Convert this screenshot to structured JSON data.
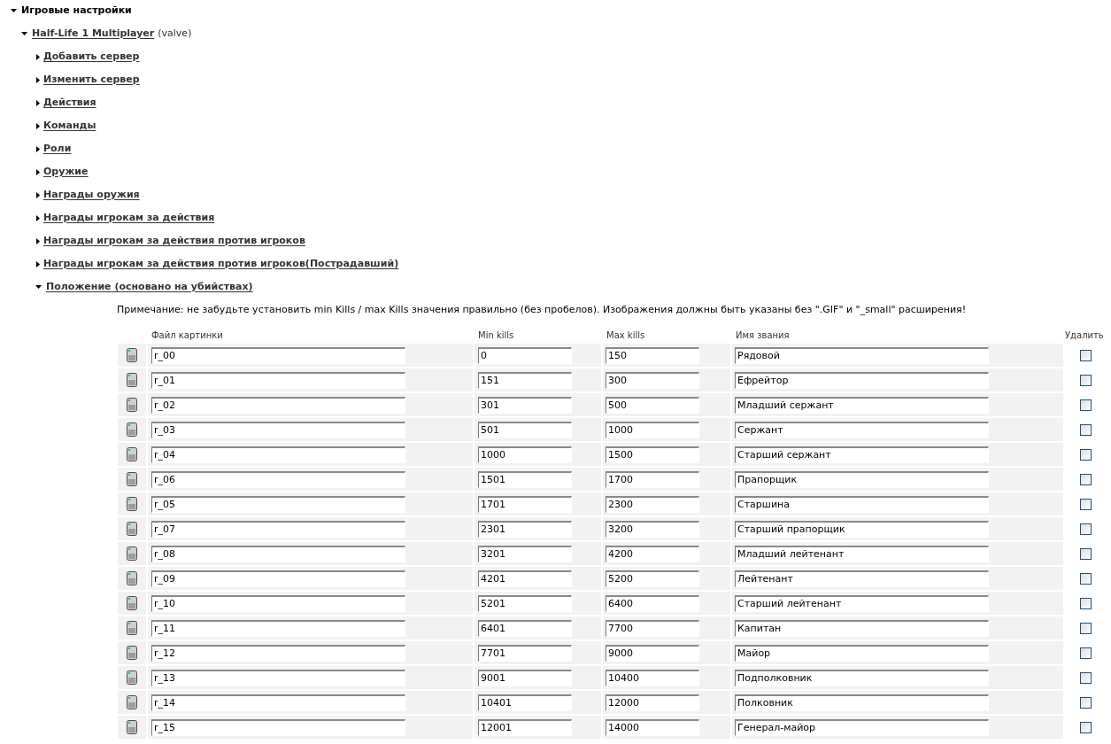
{
  "tree": {
    "label": "Игровые настройки",
    "expanded": true,
    "children": [
      {
        "label": "Half-Life 1 Multiplayer",
        "note": "(valve)",
        "expanded": true,
        "children": [
          {
            "label": "Добавить сервер",
            "expanded": false
          },
          {
            "label": "Изменить сервер",
            "expanded": false
          },
          {
            "label": "Действия",
            "expanded": false
          },
          {
            "label": "Команды",
            "expanded": false
          },
          {
            "label": "Роли",
            "expanded": false
          },
          {
            "label": "Оружие",
            "expanded": false
          },
          {
            "label": "Награды оружия",
            "expanded": false
          },
          {
            "label": "Награды игрокам за действия",
            "expanded": false
          },
          {
            "label": "Награды игрокам за действия против игроков",
            "expanded": false
          },
          {
            "label": "Награды игрокам за действия против игроков(Пострадавший)",
            "expanded": false
          },
          {
            "label": "Положение (основано на убийствах)",
            "expanded": true,
            "panel": {
              "note": "Примечание: не забудьте установить min Kills / max Kills значения правильно (без пробелов). Изображения должны быть указаны без \".GIF\" и \"_small\" расширения!",
              "columns": [
                "Файл картинки",
                "Min kills",
                "Max kills",
                "Имя звания",
                "Удалить"
              ],
              "rows": [
                {
                  "image_file": "r_00",
                  "min_kills": "0",
                  "max_kills": "150",
                  "rank_name": "Рядовой",
                  "delete": false
                },
                {
                  "image_file": "r_01",
                  "min_kills": "151",
                  "max_kills": "300",
                  "rank_name": "Ефрейтор",
                  "delete": false
                },
                {
                  "image_file": "r_02",
                  "min_kills": "301",
                  "max_kills": "500",
                  "rank_name": "Младший сержант",
                  "delete": false
                },
                {
                  "image_file": "r_03",
                  "min_kills": "501",
                  "max_kills": "1000",
                  "rank_name": "Сержант",
                  "delete": false
                },
                {
                  "image_file": "r_04",
                  "min_kills": "1000",
                  "max_kills": "1500",
                  "rank_name": "Старший сержант",
                  "delete": false
                },
                {
                  "image_file": "r_06",
                  "min_kills": "1501",
                  "max_kills": "1700",
                  "rank_name": "Прапорщик",
                  "delete": false
                },
                {
                  "image_file": "r_05",
                  "min_kills": "1701",
                  "max_kills": "2300",
                  "rank_name": "Старшина",
                  "delete": false
                },
                {
                  "image_file": "r_07",
                  "min_kills": "2301",
                  "max_kills": "3200",
                  "rank_name": "Старший прапорщик",
                  "delete": false
                },
                {
                  "image_file": "r_08",
                  "min_kills": "3201",
                  "max_kills": "4200",
                  "rank_name": "Младший лейтенант",
                  "delete": false
                },
                {
                  "image_file": "r_09",
                  "min_kills": "4201",
                  "max_kills": "5200",
                  "rank_name": "Лейтенант",
                  "delete": false
                },
                {
                  "image_file": "r_10",
                  "min_kills": "5201",
                  "max_kills": "6400",
                  "rank_name": "Старший лейтенант",
                  "delete": false
                },
                {
                  "image_file": "r_11",
                  "min_kills": "6401",
                  "max_kills": "7700",
                  "rank_name": "Капитан",
                  "delete": false
                },
                {
                  "image_file": "r_12",
                  "min_kills": "7701",
                  "max_kills": "9000",
                  "rank_name": "Майор",
                  "delete": false
                },
                {
                  "image_file": "r_13",
                  "min_kills": "9001",
                  "max_kills": "10400",
                  "rank_name": "Подполковник",
                  "delete": false
                },
                {
                  "image_file": "r_14",
                  "min_kills": "10401",
                  "max_kills": "12000",
                  "rank_name": "Полковник",
                  "delete": false
                },
                {
                  "image_file": "r_15",
                  "min_kills": "12001",
                  "max_kills": "14000",
                  "rank_name": "Генерал-майор",
                  "delete": false
                }
              ]
            }
          }
        ]
      }
    ]
  }
}
